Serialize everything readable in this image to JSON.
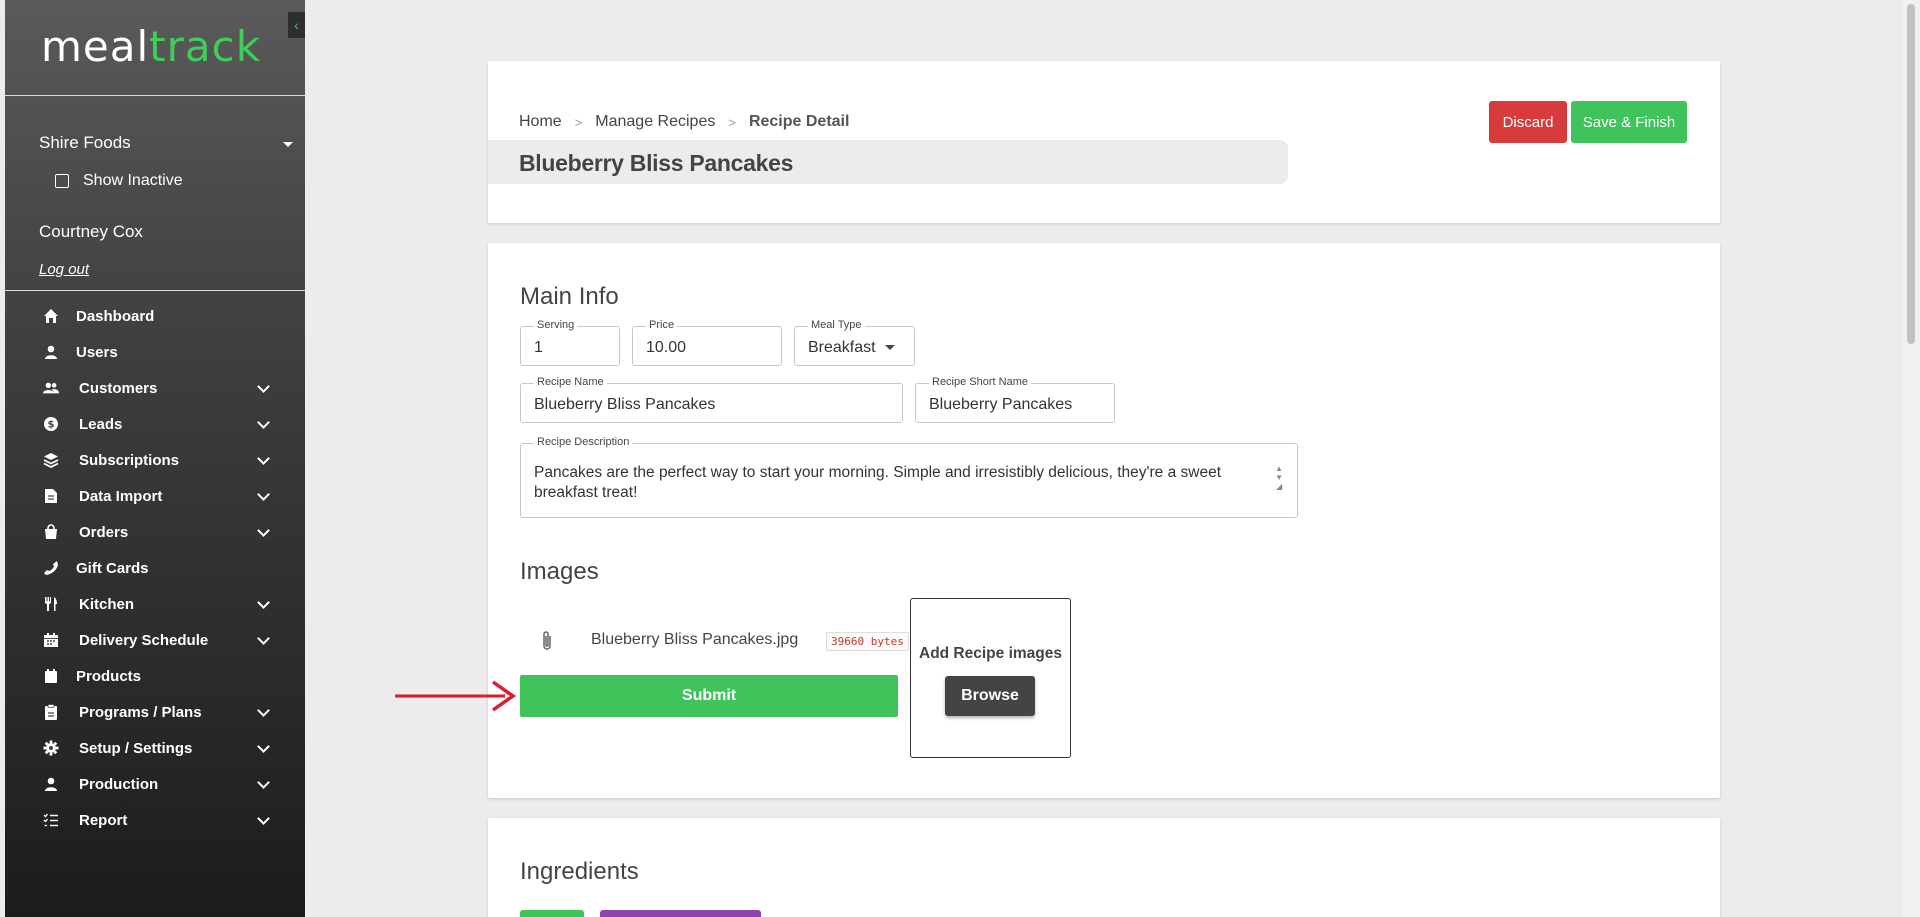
{
  "sidebar": {
    "logo_meal": "meal",
    "logo_track": "track",
    "collapse_icon": "chevron-left-icon",
    "company": "Shire Foods",
    "show_inactive": "Show Inactive",
    "user_name": "Courtney Cox",
    "logout": "Log out",
    "items": [
      {
        "label": "Dashboard",
        "icon": "home-icon",
        "has_children": false
      },
      {
        "label": "Users",
        "icon": "user-icon",
        "has_children": false
      },
      {
        "label": "Customers",
        "icon": "users-icon",
        "has_children": true
      },
      {
        "label": "Leads",
        "icon": "dollar-circle-icon",
        "has_children": true
      },
      {
        "label": "Subscriptions",
        "icon": "layers-icon",
        "has_children": true
      },
      {
        "label": "Data Import",
        "icon": "file-icon",
        "has_children": true
      },
      {
        "label": "Orders",
        "icon": "shopping-bag-icon",
        "has_children": true
      },
      {
        "label": "Gift Cards",
        "icon": "phone-icon",
        "has_children": false
      },
      {
        "label": "Kitchen",
        "icon": "utensils-icon",
        "has_children": true
      },
      {
        "label": "Delivery Schedule",
        "icon": "calendar-icon",
        "has_children": true
      },
      {
        "label": "Products",
        "icon": "box-icon",
        "has_children": false
      },
      {
        "label": "Programs / Plans",
        "icon": "clipboard-icon",
        "has_children": true
      },
      {
        "label": "Setup / Settings",
        "icon": "gear-icon",
        "has_children": true
      },
      {
        "label": "Production",
        "icon": "user-icon",
        "has_children": true
      },
      {
        "label": "Report",
        "icon": "list-icon",
        "has_children": true
      }
    ]
  },
  "header": {
    "breadcrumb": [
      "Home",
      "Manage Recipes",
      "Recipe Detail"
    ],
    "breadcrumb_sep": ">",
    "title": "Blueberry Bliss Pancakes",
    "discard_label": "Discard",
    "save_label": "Save & Finish"
  },
  "main_info": {
    "section_title": "Main Info",
    "serving": {
      "label": "Serving",
      "value": "1"
    },
    "price": {
      "label": "Price",
      "value": "10.00"
    },
    "meal_type": {
      "label": "Meal Type",
      "value": "Breakfast"
    },
    "recipe_name": {
      "label": "Recipe Name",
      "value": "Blueberry Bliss Pancakes"
    },
    "recipe_short_name": {
      "label": "Recipe Short Name",
      "value": "Blueberry Pancakes"
    },
    "recipe_description": {
      "label": "Recipe Description",
      "value": "Pancakes are the perfect way to start your morning. Simple and irresistibly delicious, they're a sweet breakfast treat!"
    }
  },
  "images": {
    "section_title": "Images",
    "file_name": "Blueberry Bliss Pancakes.jpg",
    "file_size": "39660 bytes",
    "submit_label": "Submit",
    "upload_title": "Add Recipe images",
    "browse_label": "Browse"
  },
  "ingredients": {
    "section_title": "Ingredients"
  },
  "colors": {
    "accent_green": "#3ec45a",
    "discard_red": "#d83b3b",
    "annotation_arrow": "#e0192f",
    "purple_button": "#8e44ad"
  }
}
